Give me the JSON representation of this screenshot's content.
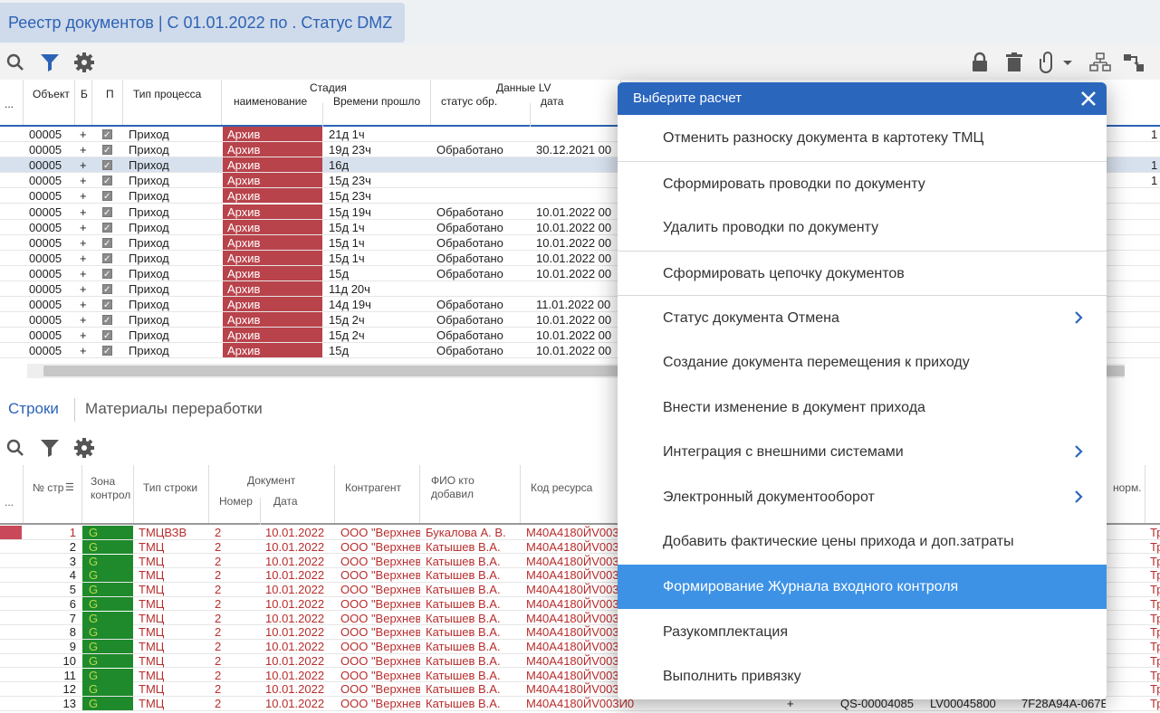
{
  "title": "Реестр документов | С 01.01.2022 по . Статус DMZ",
  "toolbar": {
    "search_icon": "search-icon",
    "filter_icon": "filter-icon",
    "settings_icon": "gear-icon"
  },
  "upper_grid": {
    "headers": {
      "more": "...",
      "object": "Объект",
      "b": "Б",
      "p": "П",
      "process_type": "Тип процесса",
      "stage": "Стадия",
      "stage_name": "наименование",
      "stage_time": "Времени прошло",
      "lv": "Данные LV",
      "lv_status": "статус обр.",
      "lv_date": "дата"
    },
    "rows": [
      {
        "obj": "00005",
        "b": "+",
        "type": "Приход",
        "stage": "Архив",
        "time": "21д 1ч",
        "status": "",
        "date": "",
        "extra": "1"
      },
      {
        "obj": "00005",
        "b": "+",
        "type": "Приход",
        "stage": "Архив",
        "time": "19д 23ч",
        "status": "Обработано",
        "date": "30.12.2021 00",
        "extra": ""
      },
      {
        "obj": "00005",
        "b": "+",
        "type": "Приход",
        "stage": "Архив",
        "time": "16д",
        "status": "",
        "date": "",
        "extra": "1"
      },
      {
        "obj": "00005",
        "b": "+",
        "type": "Приход",
        "stage": "Архив",
        "time": "15д 23ч",
        "status": "",
        "date": "",
        "extra": "1"
      },
      {
        "obj": "00005",
        "b": "+",
        "type": "Приход",
        "stage": "Архив",
        "time": "15д 23ч",
        "status": "",
        "date": "",
        "extra": ""
      },
      {
        "obj": "00005",
        "b": "+",
        "type": "Приход",
        "stage": "Архив",
        "time": "15д 19ч",
        "status": "Обработано",
        "date": "10.01.2022 00",
        "extra": ""
      },
      {
        "obj": "00005",
        "b": "+",
        "type": "Приход",
        "stage": "Архив",
        "time": "15д 1ч",
        "status": "Обработано",
        "date": "10.01.2022 00",
        "extra": ""
      },
      {
        "obj": "00005",
        "b": "+",
        "type": "Приход",
        "stage": "Архив",
        "time": "15д 1ч",
        "status": "Обработано",
        "date": "10.01.2022 00",
        "extra": ""
      },
      {
        "obj": "00005",
        "b": "+",
        "type": "Приход",
        "stage": "Архив",
        "time": "15д 1ч",
        "status": "Обработано",
        "date": "10.01.2022 00",
        "extra": ""
      },
      {
        "obj": "00005",
        "b": "+",
        "type": "Приход",
        "stage": "Архив",
        "time": "15д",
        "status": "Обработано",
        "date": "10.01.2022 00",
        "extra": ""
      },
      {
        "obj": "00005",
        "b": "+",
        "type": "Приход",
        "stage": "Архив",
        "time": "11д 20ч",
        "status": "",
        "date": "",
        "extra": ""
      },
      {
        "obj": "00005",
        "b": "+",
        "type": "Приход",
        "stage": "Архив",
        "time": "14д 19ч",
        "status": "Обработано",
        "date": "11.01.2022 00",
        "extra": ""
      },
      {
        "obj": "00005",
        "b": "+",
        "type": "Приход",
        "stage": "Архив",
        "time": "15д 2ч",
        "status": "Обработано",
        "date": "10.01.2022 00",
        "extra": ""
      },
      {
        "obj": "00005",
        "b": "+",
        "type": "Приход",
        "stage": "Архив",
        "time": "15д 2ч",
        "status": "Обработано",
        "date": "10.01.2022 00",
        "extra": ""
      },
      {
        "obj": "00005",
        "b": "+",
        "type": "Приход",
        "stage": "Архив",
        "time": "15д",
        "status": "Обработано",
        "date": "10.01.2022 00",
        "extra": ""
      }
    ]
  },
  "bottom_tabs": {
    "lines": "Строки",
    "materials": "Материалы переработки"
  },
  "lower_grid": {
    "headers": {
      "more": "...",
      "line_no": "№ стр",
      "zone": "Зона контрол",
      "line_type": "Тип строки",
      "document": "Документ",
      "doc_no": "Номер",
      "doc_date": "Дата",
      "counterparty": "Контрагент",
      "added_by": "ФИО кто добавил",
      "resource": "Код ресурса",
      "norm": "норм."
    },
    "rows": [
      {
        "n": "1",
        "zone": "G",
        "type": "ТМЦВЗВ",
        "num": "2",
        "date": "10.01.2022",
        "cp": "ООО \"Верхнев",
        "who": "Букалова А. В.",
        "res": "М40А4180ЙV003",
        "h": true
      },
      {
        "n": "2",
        "zone": "G",
        "type": "ТМЦ",
        "num": "2",
        "date": "10.01.2022",
        "cp": "ООО \"Верхнев",
        "who": "Катышев В.А.",
        "res": "М40А4180ЙV003",
        "h": false
      },
      {
        "n": "3",
        "zone": "G",
        "type": "ТМЦ",
        "num": "2",
        "date": "10.01.2022",
        "cp": "ООО \"Верхнев",
        "who": "Катышев В.А.",
        "res": "М40А4180ЙV003",
        "h": false
      },
      {
        "n": "4",
        "zone": "G",
        "type": "ТМЦ",
        "num": "2",
        "date": "10.01.2022",
        "cp": "ООО \"Верхнев",
        "who": "Катышев В.А.",
        "res": "М40А4180ЙV003",
        "h": false
      },
      {
        "n": "5",
        "zone": "G",
        "type": "ТМЦ",
        "num": "2",
        "date": "10.01.2022",
        "cp": "ООО \"Верхнев",
        "who": "Катышев В.А.",
        "res": "М40А4180ЙV003",
        "h": false
      },
      {
        "n": "6",
        "zone": "G",
        "type": "ТМЦ",
        "num": "2",
        "date": "10.01.2022",
        "cp": "ООО \"Верхнев",
        "who": "Катышев В.А.",
        "res": "М40А4180ЙV003",
        "h": false
      },
      {
        "n": "7",
        "zone": "G",
        "type": "ТМЦ",
        "num": "2",
        "date": "10.01.2022",
        "cp": "ООО \"Верхнев",
        "who": "Катышев В.А.",
        "res": "М40А4180ЙV003",
        "h": false
      },
      {
        "n": "8",
        "zone": "G",
        "type": "ТМЦ",
        "num": "2",
        "date": "10.01.2022",
        "cp": "ООО \"Верхнев",
        "who": "Катышев В.А.",
        "res": "М40А4180ЙV003",
        "h": false
      },
      {
        "n": "9",
        "zone": "G",
        "type": "ТМЦ",
        "num": "2",
        "date": "10.01.2022",
        "cp": "ООО \"Верхнев",
        "who": "Катышев В.А.",
        "res": "М40А4180ЙV003",
        "h": false
      },
      {
        "n": "10",
        "zone": "G",
        "type": "ТМЦ",
        "num": "2",
        "date": "10.01.2022",
        "cp": "ООО \"Верхнев",
        "who": "Катышев В.А.",
        "res": "М40А4180ЙV003",
        "h": false
      },
      {
        "n": "11",
        "zone": "G",
        "type": "ТМЦ",
        "num": "2",
        "date": "10.01.2022",
        "cp": "ООО \"Верхнев",
        "who": "Катышев В.А.",
        "res": "М40А4180ЙV003",
        "h": false
      },
      {
        "n": "12",
        "zone": "G",
        "type": "ТМЦ",
        "num": "2",
        "date": "10.01.2022",
        "cp": "ООО \"Верхнев",
        "who": "Катышев В.А.",
        "res": "М40А4180ЙV003",
        "h": false
      },
      {
        "n": "13",
        "zone": "G",
        "type": "ТМЦ",
        "num": "2",
        "date": "10.01.2022",
        "cp": "ООО \"Верхнев",
        "who": "Катышев В.А.",
        "res": "М40А4180ЙV003И0",
        "h": false
      }
    ],
    "partial_tail": {
      "plus": "+",
      "qs": "QS-00004085",
      "lv": "LV00045800",
      "hash": "7F28A94A-067E",
      "tr": "Тр"
    }
  },
  "modal": {
    "title": "Выберите расчет",
    "items": [
      {
        "label": "Отменить разноску документа в картотеку ТМЦ",
        "sep": false,
        "sub": false,
        "hl": false
      },
      {
        "label": "Сформировать проводки по документу",
        "sep": true,
        "sub": false,
        "hl": false
      },
      {
        "label": "Удалить проводки по документу",
        "sep": false,
        "sub": false,
        "hl": false
      },
      {
        "label": "Сформировать цепочку документов",
        "sep": true,
        "sub": false,
        "hl": false
      },
      {
        "label": "Статус документа Отмена",
        "sep": true,
        "sub": true,
        "hl": false
      },
      {
        "label": "Создание документа перемещения к приходу",
        "sep": false,
        "sub": false,
        "hl": false
      },
      {
        "label": "Внести изменение в документ прихода",
        "sep": false,
        "sub": false,
        "hl": false
      },
      {
        "label": "Интеграция с внешними системами",
        "sep": false,
        "sub": true,
        "hl": false
      },
      {
        "label": "Электронный документооборот",
        "sep": false,
        "sub": true,
        "hl": false
      },
      {
        "label": "Добавить фактические цены прихода и доп.затраты",
        "sep": false,
        "sub": false,
        "hl": false
      },
      {
        "label": "Формирование Журнала входного контроля",
        "sep": false,
        "sub": false,
        "hl": true
      },
      {
        "label": "Разукомплектация",
        "sep": false,
        "sub": false,
        "hl": false
      },
      {
        "label": "Выполнить привязку",
        "sep": false,
        "sub": false,
        "hl": false
      }
    ]
  },
  "colors": {
    "accent": "#2b66bd",
    "archive": "#b9434b",
    "zone_green": "#1e8a2b",
    "highlight": "#3d92e6"
  }
}
